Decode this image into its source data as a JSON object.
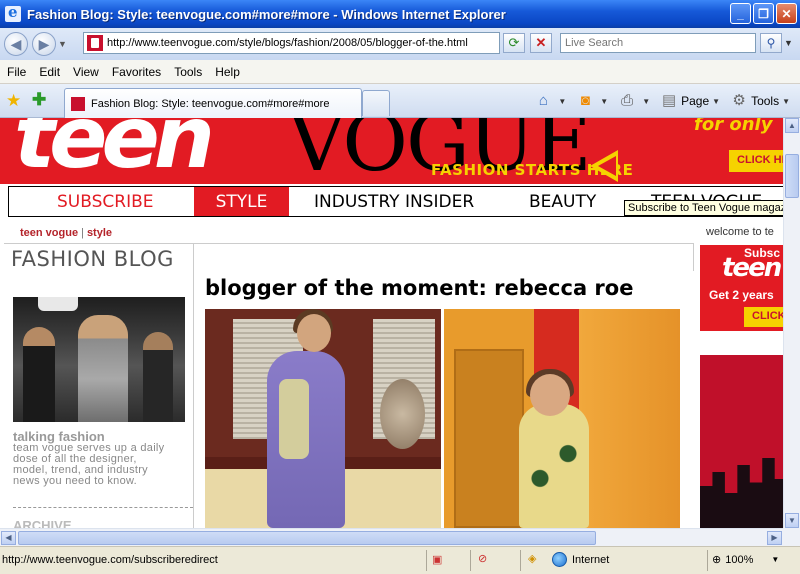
{
  "window": {
    "title": "Fashion Blog: Style: teenvogue.com#more#more - Windows Internet Explorer",
    "buttons": {
      "minimize": "_",
      "maximize": "❐",
      "close": "✕"
    }
  },
  "addressbar": {
    "url": "http://www.teenvogue.com/style/blogs/fashion/2008/05/blogger-of-the.html",
    "search_placeholder": "Live Search"
  },
  "menu": [
    "File",
    "Edit",
    "View",
    "Favorites",
    "Tools",
    "Help"
  ],
  "tabs": {
    "active_title": "Fashion Blog: Style: teenvogue.com#more#more"
  },
  "toolbar": {
    "page_label": "Page",
    "tools_label": "Tools"
  },
  "page": {
    "banner": {
      "logo_teen": "teen",
      "logo_vogue": "VOGUE",
      "tagline": "FASHION STARTS HERE",
      "promo_text": "for only",
      "click_here": "CLICK HE"
    },
    "nav": {
      "subscribe": "SUBSCRIBE",
      "style": "STYLE",
      "industry_insider": "INDUSTRY INSIDER",
      "beauty": "BEAUTY",
      "more": "TEEN VOGUE"
    },
    "tooltip": "Subscribe to Teen Vogue magazine",
    "breadcrumb": {
      "home": "teen vogue",
      "section": "style"
    },
    "welcome": "welcome to te",
    "blog_header": "FASHION BLOG",
    "sidebar": {
      "feature_title": "talking fashion",
      "feature_body": [
        "team vogue serves up a daily",
        "dose of all the designer,",
        "model, trend, and industry",
        "news you need to know."
      ],
      "archive_label": "ARCHIVE"
    },
    "post_title": "blogger of the moment: rebecca roe",
    "ad": {
      "line1": "Subsc",
      "logo": "teen",
      "line2": "Get 2 years",
      "click": "CLICK"
    }
  },
  "status": {
    "text": "http://www.teenvogue.com/subscriberedirect",
    "zone": "Internet",
    "zoom": "100%"
  }
}
